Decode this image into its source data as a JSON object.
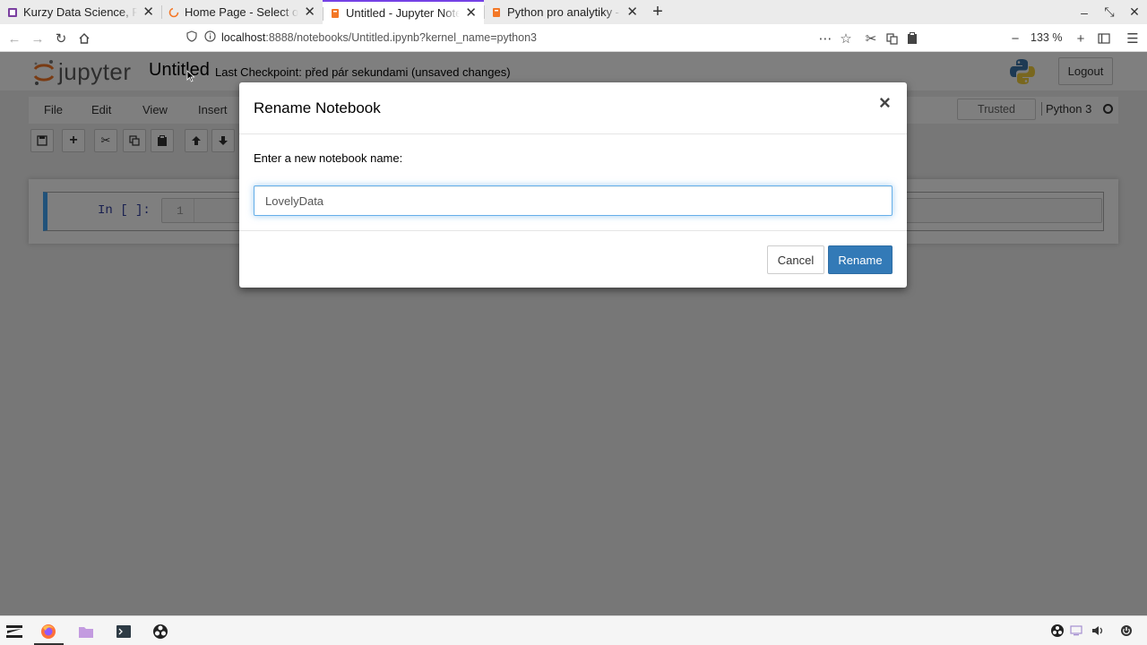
{
  "browser": {
    "tabs": [
      {
        "title": "Kurzy Data Science, Pyth",
        "active": false,
        "icon": "purple-book-icon"
      },
      {
        "title": "Home Page - Select or cr",
        "active": false,
        "icon": "jupyter-spinner-icon"
      },
      {
        "title": "Untitled - Jupyter Noteb",
        "active": true,
        "icon": "notebook-icon"
      },
      {
        "title": "Python pro analytiky - Ty",
        "active": false,
        "icon": "notebook-icon"
      }
    ],
    "new_tab_label": "+",
    "url_host": "localhost",
    "url_rest": ":8888/notebooks/Untitled.ipynb?kernel_name=python3",
    "zoom": "133 %"
  },
  "jupyter": {
    "logo_text": "jupyter",
    "notebook_name": "Untitled",
    "checkpoint_text": "Last Checkpoint: před pár sekundami  (unsaved changes)",
    "logout_label": "Logout",
    "menu": [
      "File",
      "Edit",
      "View",
      "Insert"
    ],
    "trusted_label": "Trusted",
    "kernel_name": "Python 3",
    "cell": {
      "prompt": "In [ ]:",
      "line_number": "1"
    }
  },
  "modal": {
    "title": "Rename Notebook",
    "close_glyph": "×",
    "label": "Enter a new notebook name:",
    "input_value": "LovelyData",
    "cancel_label": "Cancel",
    "rename_label": "Rename"
  },
  "colors": {
    "accent_tab": "#7542e5",
    "primary_button": "#337ab7",
    "cell_selected_border": "#42a5f5",
    "jupyter_orange": "#f37726"
  }
}
